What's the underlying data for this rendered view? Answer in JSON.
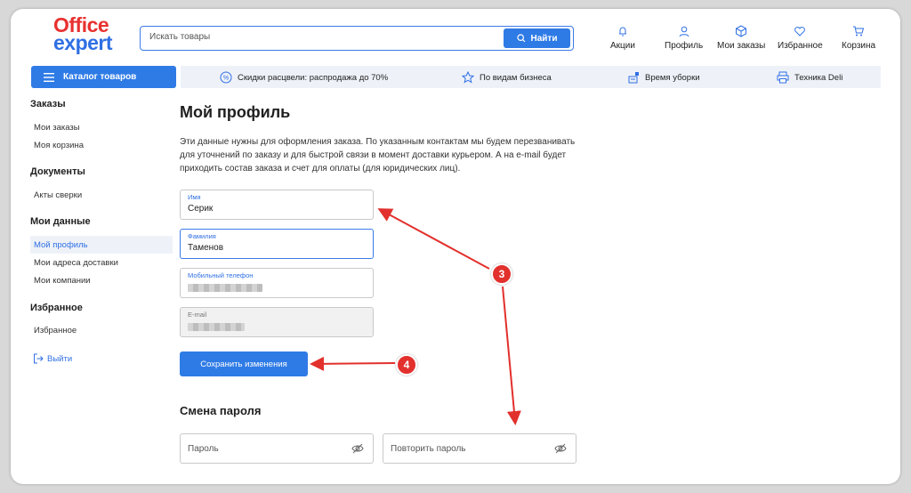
{
  "brand": {
    "line1": "Office",
    "line2": "expert",
    "accent": "#e8312f",
    "primary": "#2f7be6"
  },
  "search": {
    "placeholder": "Искать товары",
    "button": "Найти"
  },
  "header_nav": [
    {
      "label": "Акции",
      "icon": "bell-icon"
    },
    {
      "label": "Профиль",
      "icon": "user-icon"
    },
    {
      "label": "Мои заказы",
      "icon": "box-icon"
    },
    {
      "label": "Избранное",
      "icon": "heart-icon"
    },
    {
      "label": "Корзина",
      "icon": "cart-icon"
    }
  ],
  "catalog_button": "Каталог товаров",
  "promo": [
    {
      "label": "Скидки расцвели: распродажа до 70%",
      "icon": "percent-icon"
    },
    {
      "label": "По видам бизнеса",
      "icon": "star-icon"
    },
    {
      "label": "Время уборки",
      "icon": "mop-icon"
    },
    {
      "label": "Техника Deli",
      "icon": "printer-icon"
    }
  ],
  "sidebar": {
    "orders_heading": "Заказы",
    "my_orders": "Мои заказы",
    "my_cart": "Моя корзина",
    "documents_heading": "Документы",
    "reconciliation": "Акты сверки",
    "my_data_heading": "Мои данные",
    "my_profile": "Мой профиль",
    "addresses": "Мои адреса доставки",
    "companies": "Мои компании",
    "favorites_heading": "Избранное",
    "favorites": "Избранное",
    "logout": "Выйти"
  },
  "main": {
    "title": "Мой профиль",
    "description": "Эти данные нужны для оформления заказа. По указанным контактам мы будем перезванивать для уточнений по заказу и для быстрой связи в момент доставки курьером. А на e-mail будет приходить состав заказа и счет для оплаты (для юридических лиц).",
    "first_name": {
      "label": "Имя",
      "value": "Серик"
    },
    "last_name": {
      "label": "Фамилия",
      "value": "Таменов"
    },
    "phone": {
      "label": "Мобильный телефон"
    },
    "email": {
      "label": "E-mail"
    },
    "save_button": "Сохранить изменения",
    "password_heading": "Смена пароля",
    "password_placeholder": "Пароль",
    "password_repeat_placeholder": "Повторить пароль"
  },
  "annotations": {
    "badge_3": "3",
    "badge_4": "4",
    "color": "#e2302c"
  }
}
